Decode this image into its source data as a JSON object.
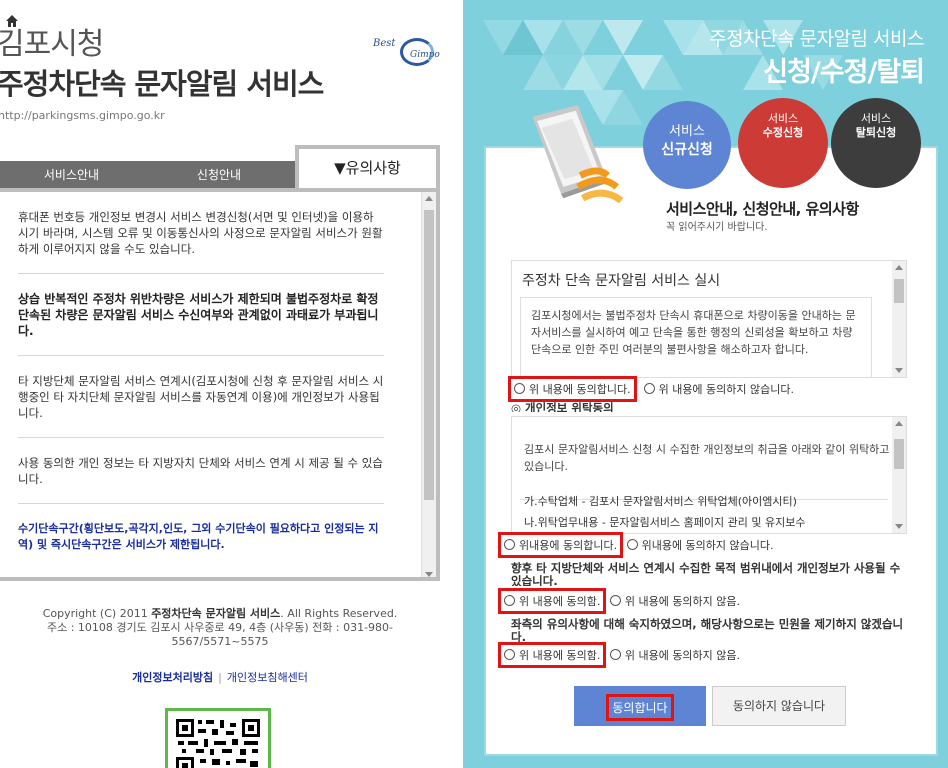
{
  "left": {
    "city": "김포시청",
    "service": "주정차단속 문자알림 서비스",
    "url": "http://parkingsms.gimpo.go.kr",
    "logo": {
      "best": "Best",
      "gimpo": "Gimpo"
    },
    "tabs": {
      "service_info": "서비스안내",
      "apply_info": "신청안내",
      "notice": "▼유의사항"
    },
    "notices": [
      "휴대폰 번호등 개인정보 변경시 서비스 변경신청(서면 및 인터넷)을 이용하시기 바라며, 시스템 오류 및 이동통신사의 사정으로 문자알림 서비스가 원활하게 이루어지지 않을 수도 있습니다.",
      "상습 반복적인 주정차 위반차량은 서비스가 제한되며 불법주정차로 확정단속된 차량은 문자알림 서비스 수신여부와 관계없이 과태료가 부과됩니다.",
      "타 지방단체 문자알림 서비스 연계시(김포시청에 신청 후 문자알림 서비스 시행중인 타 자치단체 문자알림 서비스를 자동연계 이용)에 개인정보가 사용됩니다.",
      "사용 동의한 개인 정보는 타 지방자치 단체와 서비스 연계 시 제공 될 수 있습니다.",
      "수기단속구간(횡단보도,곡각지,인도, 그외 수기단속이 필요하다고 인정되는 지역) 및 즉시단속구간은 서비스가 제한됩니다."
    ],
    "footer": {
      "copyright_pre": "Copyright (C) 2011 ",
      "copyright_name": "주정차단속 문자알림 서비스",
      "copyright_post": ". All Rights Reserved.",
      "address": "주소 : 10108 경기도 김포시 사우중로 49, 4층 (사우동) 전화 : 031-980-5567/5571~5575",
      "privacy_link": "개인정보처리방침",
      "sep": "|",
      "report_link": "개인정보침해센터"
    }
  },
  "right": {
    "header_sub": "주정차단속 문자알림 서비스",
    "header_main": "신청/수정/탈퇴",
    "circles": {
      "new_top": "서비스",
      "new_bottom": "신규신청",
      "mod_top": "서비스",
      "mod_bottom": "수정신청",
      "del_top": "서비스",
      "del_bottom": "탈퇴신청"
    },
    "card_title": "서비스안내, 신청안내, 유의사항",
    "card_sub": "꼭 읽어주시기 바랍니다.",
    "terms1": {
      "head": "주정차 단속 문자알림 서비스 실시",
      "body": "김포시청에서는 불법주정차 단속시 휴대폰으로 차량이동을 안내하는 문자서비스를 실시하여 예고 단속을 통한 행정의 신뢰성을 확보하고 차량단속으로 인한 주민 여러분의 불편사항을 해소하고자 합니다."
    },
    "r1": {
      "agree": "위 내용에 동의합니다.",
      "disagree": "위 내용에 동의하지 않습니다."
    },
    "section2_head": "◎ 개인정보 위탁동의",
    "terms2": {
      "body": "김포시 문자알림서비스 신청 시 수집한 개인정보의 취급을 아래와 같이 위탁하고 있습니다.",
      "item1": "가.수탁업체 - 김포시 문자알림서비스 위탁업체(아이엠시티)",
      "item2": "나.위탁업무내용 - 문자알림서비스 홈페이지 관리 및 유지보수"
    },
    "r2": {
      "agree": "위내용에 동의합니다.",
      "disagree": "위내용에 동의하지 않습니다."
    },
    "section3_head": "향후 타 지방단체와 서비스 연계시 수집한 목적 범위내에서 개인정보가 사용될 수 있습니다.",
    "r3": {
      "agree": "위 내용에 동의함.",
      "disagree": "위 내용에 동의하지 않음."
    },
    "section4_head": "좌측의 유의사항에 대해 숙지하였으며, 해당사항으로는 민원을 제기하지 않겠습니다.",
    "r4": {
      "agree": "위 내용에 동의함.",
      "disagree": "위 내용에 동의하지 않음."
    },
    "btn_agree": "동의합니다",
    "btn_disagree": "동의하지 않습니다"
  },
  "colors": {
    "accent_blue": "#5e84d4",
    "red": "#cc3b35",
    "dark": "#3d3d3d",
    "bg_teal": "#7dd0dc",
    "highlight": "#e01414"
  }
}
